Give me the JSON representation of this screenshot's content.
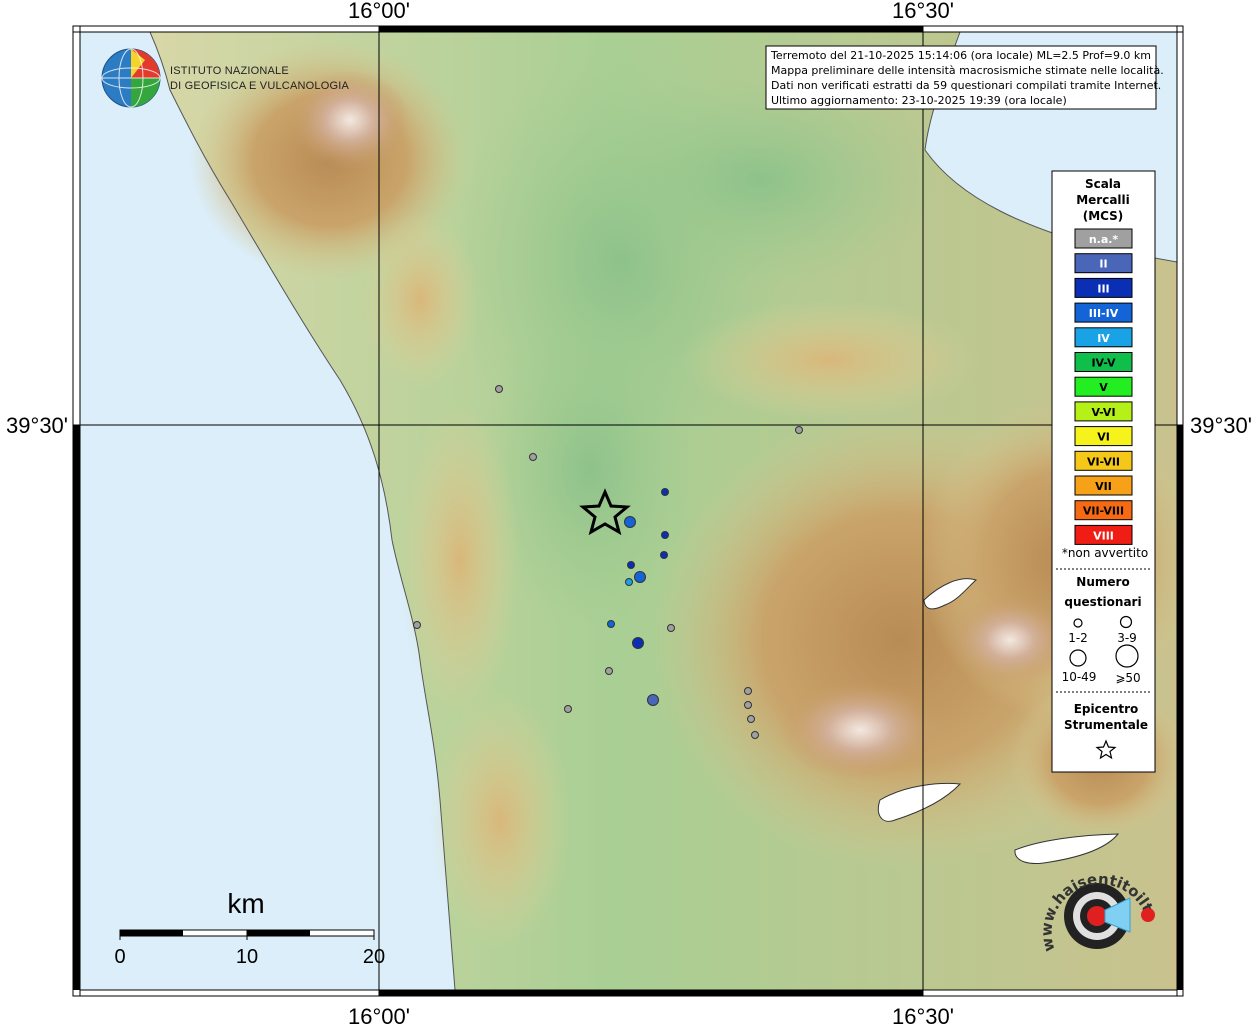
{
  "graticule": {
    "lon_labels": [
      "16°00'",
      "16°30'"
    ],
    "lat_label": "39°30'"
  },
  "info_box": {
    "lines": [
      "Terremoto del 21-10-2025 15:14:06 (ora locale) ML=2.5 Prof=9.0 km",
      "Mappa preliminare delle intensità macrosismiche stimate nelle località.",
      "Dati non verificati estratti da 59 questionari compilati tramite Internet.",
      "Ultimo aggiornamento: 23-10-2025 19:39 (ora locale)"
    ]
  },
  "ingv_logo": {
    "line1": "ISTITUTO NAZIONALE",
    "line2": "DI GEOFISICA E VULCANOLOGIA"
  },
  "legend": {
    "title_lines": [
      "Scala",
      "Mercalli",
      "(MCS)"
    ],
    "scale": [
      {
        "label": "n.a.*",
        "color": "#a0a0a0",
        "text_color": "#ffffff"
      },
      {
        "label": "II",
        "color": "#4a66b8",
        "text_color": "#ffffff"
      },
      {
        "label": "III",
        "color": "#0a2fb5",
        "text_color": "#ffffff"
      },
      {
        "label": "III-IV",
        "color": "#1464d8",
        "text_color": "#ffffff"
      },
      {
        "label": "IV",
        "color": "#1aa2e6",
        "text_color": "#ffffff"
      },
      {
        "label": "IV-V",
        "color": "#0fbf4a",
        "text_color": "#000000"
      },
      {
        "label": "V",
        "color": "#22ee22",
        "text_color": "#000000"
      },
      {
        "label": "V-VI",
        "color": "#b6f019",
        "text_color": "#000000"
      },
      {
        "label": "VI",
        "color": "#f6f21b",
        "text_color": "#000000"
      },
      {
        "label": "VI-VII",
        "color": "#f5c718",
        "text_color": "#000000"
      },
      {
        "label": "VII",
        "color": "#f6a118",
        "text_color": "#000000"
      },
      {
        "label": "VII-VIII",
        "color": "#f66a13",
        "text_color": "#000000"
      },
      {
        "label": "VIII",
        "color": "#f01d14",
        "text_color": "#ffffff"
      }
    ],
    "not_felt_note": "*non avvertito",
    "questionnaire_title_lines": [
      "Numero",
      "questionari"
    ],
    "questionnaire_sizes": [
      "1-2",
      "3-9",
      "10-49",
      "⩾50"
    ],
    "epicenter_title_lines": [
      "Epicentro",
      "Strumentale"
    ]
  },
  "scale_bar": {
    "unit": "km",
    "ticks": [
      "0",
      "10",
      "20"
    ]
  },
  "haisentito_logo": {
    "text": "www.haisentitoilterremoto.it"
  },
  "observations": [
    {
      "intensity": "n.a.*",
      "size": "1-2"
    },
    {
      "intensity": "n.a.*",
      "size": "1-2"
    },
    {
      "intensity": "n.a.*",
      "size": "1-2"
    },
    {
      "intensity": "n.a.*",
      "size": "1-2"
    },
    {
      "intensity": "n.a.*",
      "size": "1-2"
    },
    {
      "intensity": "n.a.*",
      "size": "1-2"
    },
    {
      "intensity": "n.a.*",
      "size": "1-2"
    },
    {
      "intensity": "n.a.*",
      "size": "1-2"
    },
    {
      "intensity": "n.a.*",
      "size": "1-2"
    },
    {
      "intensity": "n.a.*",
      "size": "1-2"
    },
    {
      "intensity": "n.a.*",
      "size": "1-2"
    },
    {
      "intensity": "III",
      "size": "1-2"
    },
    {
      "intensity": "III",
      "size": "1-2"
    },
    {
      "intensity": "III",
      "size": "1-2"
    },
    {
      "intensity": "III",
      "size": "1-2"
    },
    {
      "intensity": "III-IV",
      "size": "1-2"
    },
    {
      "intensity": "III-IV",
      "size": "3-9"
    },
    {
      "intensity": "III-IV",
      "size": "3-9"
    },
    {
      "intensity": "IV",
      "size": "1-2"
    },
    {
      "intensity": "III",
      "size": "3-9"
    },
    {
      "intensity": "II",
      "size": "3-9"
    }
  ]
}
